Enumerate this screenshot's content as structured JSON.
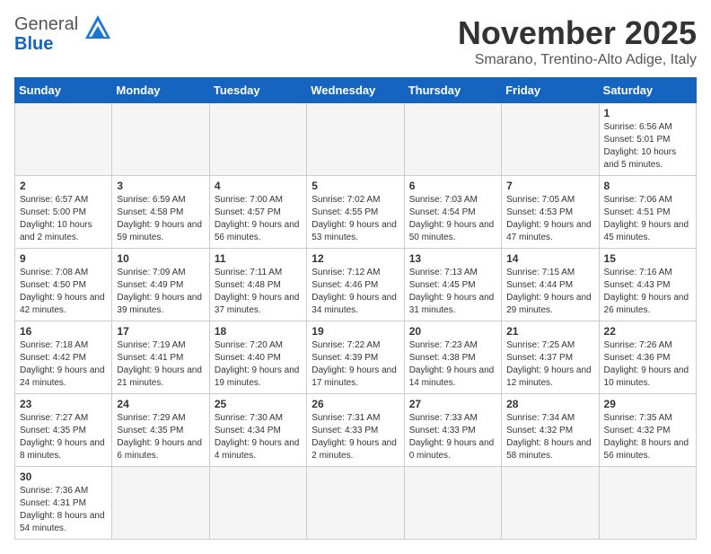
{
  "header": {
    "logo_general": "General",
    "logo_blue": "Blue",
    "month_title": "November 2025",
    "location": "Smarano, Trentino-Alto Adige, Italy"
  },
  "weekdays": [
    "Sunday",
    "Monday",
    "Tuesday",
    "Wednesday",
    "Thursday",
    "Friday",
    "Saturday"
  ],
  "weeks": [
    [
      {
        "day": "",
        "info": ""
      },
      {
        "day": "",
        "info": ""
      },
      {
        "day": "",
        "info": ""
      },
      {
        "day": "",
        "info": ""
      },
      {
        "day": "",
        "info": ""
      },
      {
        "day": "",
        "info": ""
      },
      {
        "day": "1",
        "info": "Sunrise: 6:56 AM\nSunset: 5:01 PM\nDaylight: 10 hours and 5 minutes."
      }
    ],
    [
      {
        "day": "2",
        "info": "Sunrise: 6:57 AM\nSunset: 5:00 PM\nDaylight: 10 hours and 2 minutes."
      },
      {
        "day": "3",
        "info": "Sunrise: 6:59 AM\nSunset: 4:58 PM\nDaylight: 9 hours and 59 minutes."
      },
      {
        "day": "4",
        "info": "Sunrise: 7:00 AM\nSunset: 4:57 PM\nDaylight: 9 hours and 56 minutes."
      },
      {
        "day": "5",
        "info": "Sunrise: 7:02 AM\nSunset: 4:55 PM\nDaylight: 9 hours and 53 minutes."
      },
      {
        "day": "6",
        "info": "Sunrise: 7:03 AM\nSunset: 4:54 PM\nDaylight: 9 hours and 50 minutes."
      },
      {
        "day": "7",
        "info": "Sunrise: 7:05 AM\nSunset: 4:53 PM\nDaylight: 9 hours and 47 minutes."
      },
      {
        "day": "8",
        "info": "Sunrise: 7:06 AM\nSunset: 4:51 PM\nDaylight: 9 hours and 45 minutes."
      }
    ],
    [
      {
        "day": "9",
        "info": "Sunrise: 7:08 AM\nSunset: 4:50 PM\nDaylight: 9 hours and 42 minutes."
      },
      {
        "day": "10",
        "info": "Sunrise: 7:09 AM\nSunset: 4:49 PM\nDaylight: 9 hours and 39 minutes."
      },
      {
        "day": "11",
        "info": "Sunrise: 7:11 AM\nSunset: 4:48 PM\nDaylight: 9 hours and 37 minutes."
      },
      {
        "day": "12",
        "info": "Sunrise: 7:12 AM\nSunset: 4:46 PM\nDaylight: 9 hours and 34 minutes."
      },
      {
        "day": "13",
        "info": "Sunrise: 7:13 AM\nSunset: 4:45 PM\nDaylight: 9 hours and 31 minutes."
      },
      {
        "day": "14",
        "info": "Sunrise: 7:15 AM\nSunset: 4:44 PM\nDaylight: 9 hours and 29 minutes."
      },
      {
        "day": "15",
        "info": "Sunrise: 7:16 AM\nSunset: 4:43 PM\nDaylight: 9 hours and 26 minutes."
      }
    ],
    [
      {
        "day": "16",
        "info": "Sunrise: 7:18 AM\nSunset: 4:42 PM\nDaylight: 9 hours and 24 minutes."
      },
      {
        "day": "17",
        "info": "Sunrise: 7:19 AM\nSunset: 4:41 PM\nDaylight: 9 hours and 21 minutes."
      },
      {
        "day": "18",
        "info": "Sunrise: 7:20 AM\nSunset: 4:40 PM\nDaylight: 9 hours and 19 minutes."
      },
      {
        "day": "19",
        "info": "Sunrise: 7:22 AM\nSunset: 4:39 PM\nDaylight: 9 hours and 17 minutes."
      },
      {
        "day": "20",
        "info": "Sunrise: 7:23 AM\nSunset: 4:38 PM\nDaylight: 9 hours and 14 minutes."
      },
      {
        "day": "21",
        "info": "Sunrise: 7:25 AM\nSunset: 4:37 PM\nDaylight: 9 hours and 12 minutes."
      },
      {
        "day": "22",
        "info": "Sunrise: 7:26 AM\nSunset: 4:36 PM\nDaylight: 9 hours and 10 minutes."
      }
    ],
    [
      {
        "day": "23",
        "info": "Sunrise: 7:27 AM\nSunset: 4:35 PM\nDaylight: 9 hours and 8 minutes."
      },
      {
        "day": "24",
        "info": "Sunrise: 7:29 AM\nSunset: 4:35 PM\nDaylight: 9 hours and 6 minutes."
      },
      {
        "day": "25",
        "info": "Sunrise: 7:30 AM\nSunset: 4:34 PM\nDaylight: 9 hours and 4 minutes."
      },
      {
        "day": "26",
        "info": "Sunrise: 7:31 AM\nSunset: 4:33 PM\nDaylight: 9 hours and 2 minutes."
      },
      {
        "day": "27",
        "info": "Sunrise: 7:33 AM\nSunset: 4:33 PM\nDaylight: 9 hours and 0 minutes."
      },
      {
        "day": "28",
        "info": "Sunrise: 7:34 AM\nSunset: 4:32 PM\nDaylight: 8 hours and 58 minutes."
      },
      {
        "day": "29",
        "info": "Sunrise: 7:35 AM\nSunset: 4:32 PM\nDaylight: 8 hours and 56 minutes."
      }
    ],
    [
      {
        "day": "30",
        "info": "Sunrise: 7:36 AM\nSunset: 4:31 PM\nDaylight: 8 hours and 54 minutes."
      },
      {
        "day": "",
        "info": ""
      },
      {
        "day": "",
        "info": ""
      },
      {
        "day": "",
        "info": ""
      },
      {
        "day": "",
        "info": ""
      },
      {
        "day": "",
        "info": ""
      },
      {
        "day": "",
        "info": ""
      }
    ]
  ]
}
